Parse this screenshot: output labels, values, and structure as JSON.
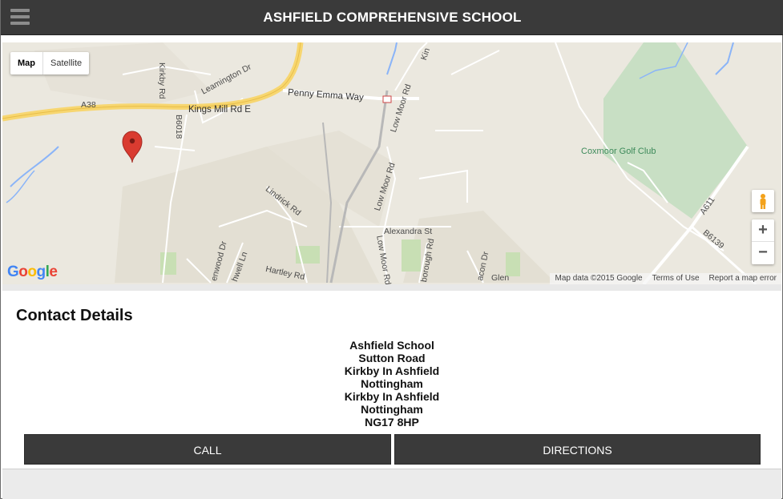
{
  "header": {
    "title": "ASHFIELD COMPREHENSIVE SCHOOL",
    "menu_icon": "hamburger-menu-icon"
  },
  "map": {
    "type_control": {
      "map_label": "Map",
      "satellite_label": "Satellite"
    },
    "labels": {
      "a38": "A38",
      "kings_mill": "Kings Mill Rd E",
      "penny_emma": "Penny Emma Way",
      "kirkby_rd": "Kirkby Rd",
      "leamington": "Leamington Dr",
      "b6018": "B6018",
      "low_moor_1": "Low Moor Rd",
      "low_moor_2": "Low Moor Rd",
      "low_moor_3": "Low Moor Rd",
      "lindrick": "Lindrick Rd",
      "alexandra": "Alexandra St",
      "coxmoor": "Coxmoor Golf Club",
      "a611": "A611",
      "b6139": "B6139",
      "hartley": "Hartley Rd",
      "penwood": "enwood Dr",
      "hwell": "hwell Ln",
      "borough": "borough Rd",
      "acon": "acon Dr",
      "glen": "Glen",
      "kin": "Kin"
    },
    "zoom_in": "+",
    "zoom_out": "−",
    "pegman_icon": "pegman-icon",
    "marker_icon": "map-marker-icon",
    "logo": "Google",
    "attribution": {
      "data": "Map data ©2015 Google",
      "terms": "Terms of Use",
      "report": "Report a map error"
    }
  },
  "contact": {
    "heading": "Contact Details",
    "address_lines": [
      "Ashfield School",
      "Sutton Road",
      "Kirkby In Ashfield",
      "Nottingham",
      "Kirkby In Ashfield",
      "Nottingham",
      "NG17 8HP"
    ],
    "call_label": "CALL",
    "directions_label": "DIRECTIONS"
  },
  "colors": {
    "header_bg": "#3a3a3a",
    "button_bg": "#3a3a3a",
    "map_bg": "#ebe8df",
    "golf_green": "#c8dfc4",
    "road_yellow": "#f7d670",
    "marker_red": "#d93b30"
  }
}
